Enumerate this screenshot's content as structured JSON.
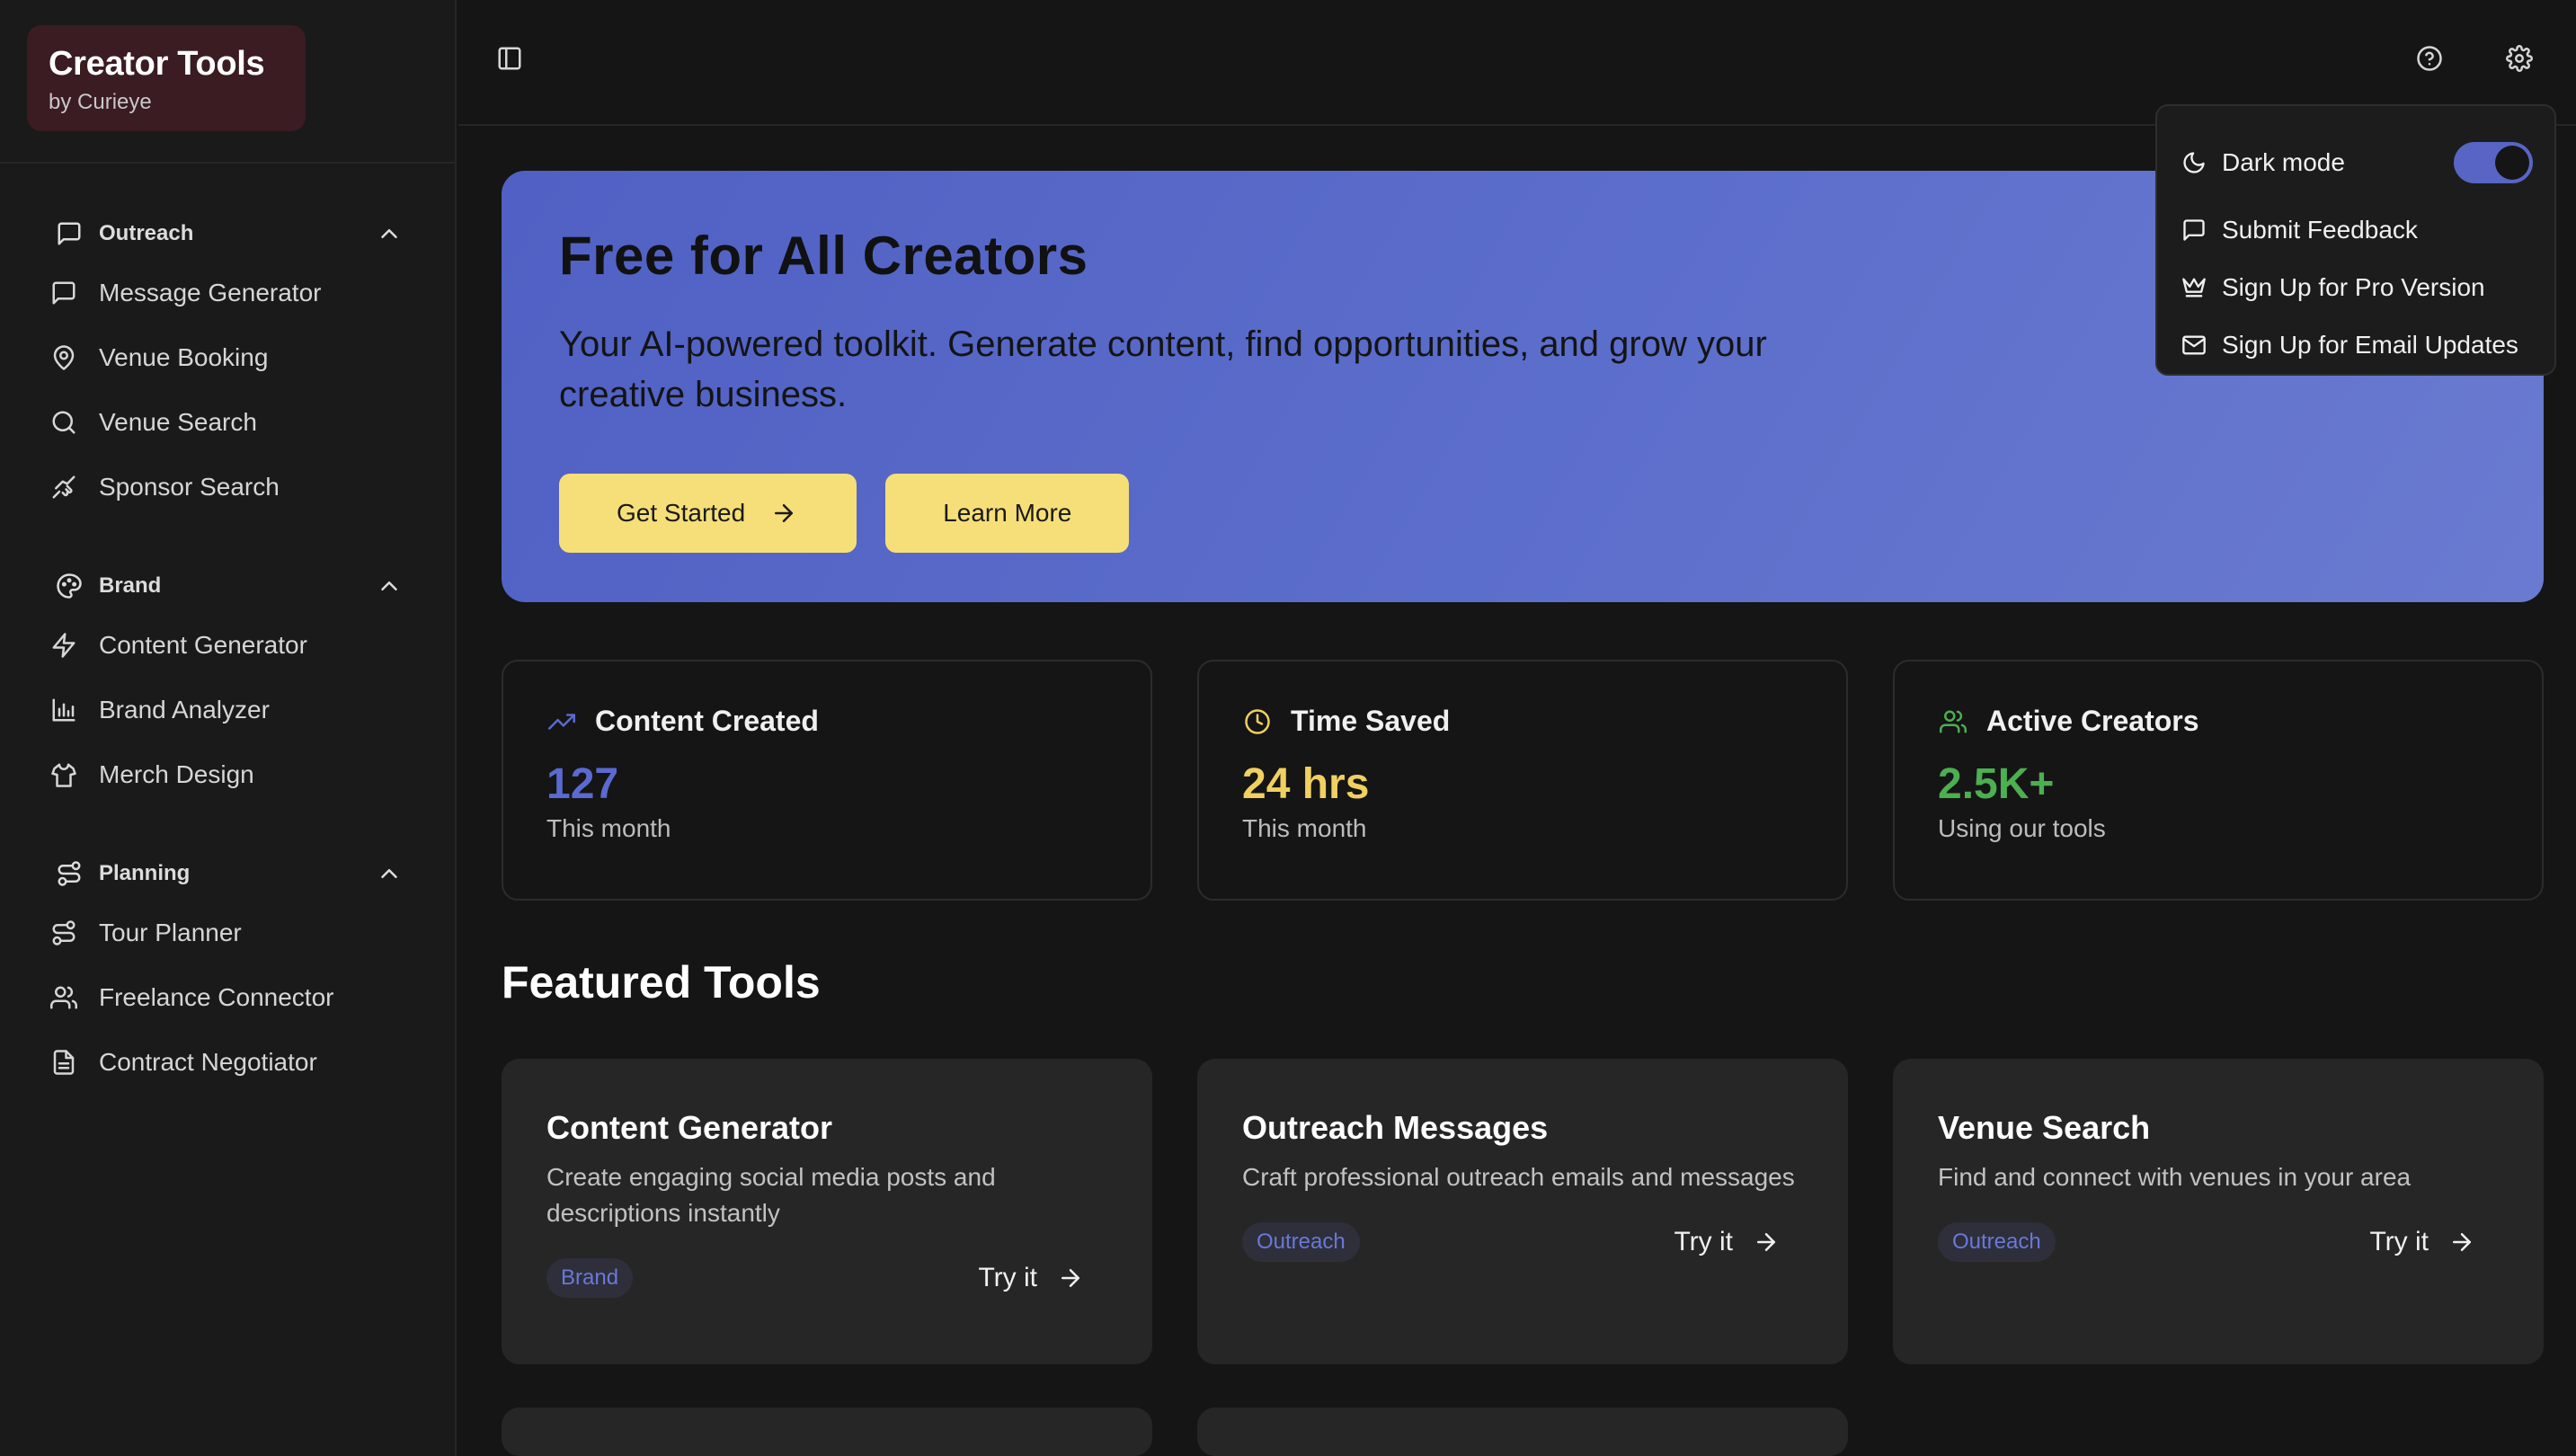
{
  "app": {
    "title": "Creator Tools",
    "subtitle": "by Curieye"
  },
  "sidebar": {
    "sections": [
      {
        "label": "Outreach",
        "icon": "message-square-icon",
        "items": [
          {
            "label": "Message Generator",
            "icon": "message-square-icon"
          },
          {
            "label": "Venue Booking",
            "icon": "map-pin-icon"
          },
          {
            "label": "Venue Search",
            "icon": "search-icon"
          },
          {
            "label": "Sponsor Search",
            "icon": "handshake-icon"
          }
        ]
      },
      {
        "label": "Brand",
        "icon": "palette-icon",
        "items": [
          {
            "label": "Content Generator",
            "icon": "zap-icon"
          },
          {
            "label": "Brand Analyzer",
            "icon": "bar-chart-icon"
          },
          {
            "label": "Merch Design",
            "icon": "shirt-icon"
          }
        ]
      },
      {
        "label": "Planning",
        "icon": "route-icon",
        "items": [
          {
            "label": "Tour Planner",
            "icon": "route-icon"
          },
          {
            "label": "Freelance Connector",
            "icon": "users-icon"
          },
          {
            "label": "Contract Negotiator",
            "icon": "file-text-icon"
          }
        ]
      }
    ]
  },
  "hero": {
    "title": "Free for All Creators",
    "description": "Your AI-powered toolkit. Generate content, find opportunities, and grow your creative business.",
    "primary_button": "Get Started",
    "secondary_button": "Learn More"
  },
  "stats": [
    {
      "title": "Content Created",
      "value": "127",
      "sub": "This month",
      "icon": "trending-up-icon",
      "color": "#5b6ad0"
    },
    {
      "title": "Time Saved",
      "value": "24 hrs",
      "sub": "This month",
      "icon": "clock-icon",
      "color": "#f0d060"
    },
    {
      "title": "Active Creators",
      "value": "2.5K+",
      "sub": "Using our tools",
      "icon": "users-icon",
      "color": "#4caf50"
    }
  ],
  "featured": {
    "title": "Featured Tools",
    "try_label": "Try it",
    "tools": [
      {
        "title": "Content Generator",
        "description": "Create engaging social media posts and descriptions instantly",
        "tag": "Brand"
      },
      {
        "title": "Outreach Messages",
        "description": "Craft professional outreach emails and messages",
        "tag": "Outreach"
      },
      {
        "title": "Venue Search",
        "description": "Find and connect with venues in your area",
        "tag": "Outreach"
      }
    ]
  },
  "settings_menu": {
    "dark_mode_label": "Dark mode",
    "dark_mode_on": true,
    "items": [
      {
        "label": "Submit Feedback",
        "icon": "message-square-icon"
      },
      {
        "label": "Sign Up for Pro Version",
        "icon": "crown-icon"
      },
      {
        "label": "Sign Up for Email Updates",
        "icon": "mail-icon"
      }
    ]
  },
  "colors": {
    "accent": "#5865c5",
    "yellow_button": "#f6df78",
    "brand_box": "#3a1c22"
  }
}
